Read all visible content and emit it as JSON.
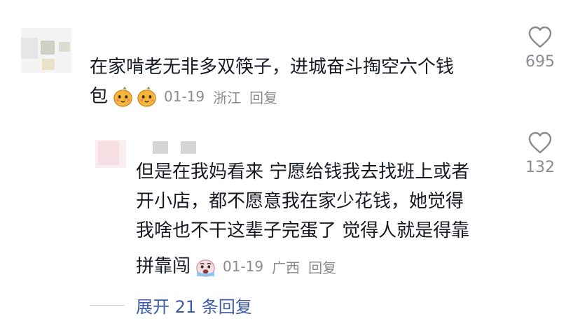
{
  "comment": {
    "lines": [
      "在家啃老无非多双筷子，进城奋斗掏空六个钱",
      "包"
    ],
    "emoji_icons": [
      "mango-face-emoji",
      "mango-face-emoji"
    ],
    "date": "01-19",
    "location": "浙江",
    "reply_label": "回复",
    "like_count": "695"
  },
  "reply": {
    "lines": [
      "但是在我妈看来 宁愿给钱我去找班上或者",
      "开小店，都不愿意我在家少花钱，她觉得",
      "我啥也不干这辈子完蛋了 觉得人就是得靠",
      "拼靠闯"
    ],
    "emoji_icons": [
      "crying-face-emoji"
    ],
    "date": "01-19",
    "location": "广西",
    "reply_label": "回复",
    "like_count": "132"
  },
  "expand": {
    "label": "展开 21 条回复"
  },
  "colors": {
    "text": "#161823",
    "meta": "#8a8b91",
    "link": "#3c5ba9"
  }
}
